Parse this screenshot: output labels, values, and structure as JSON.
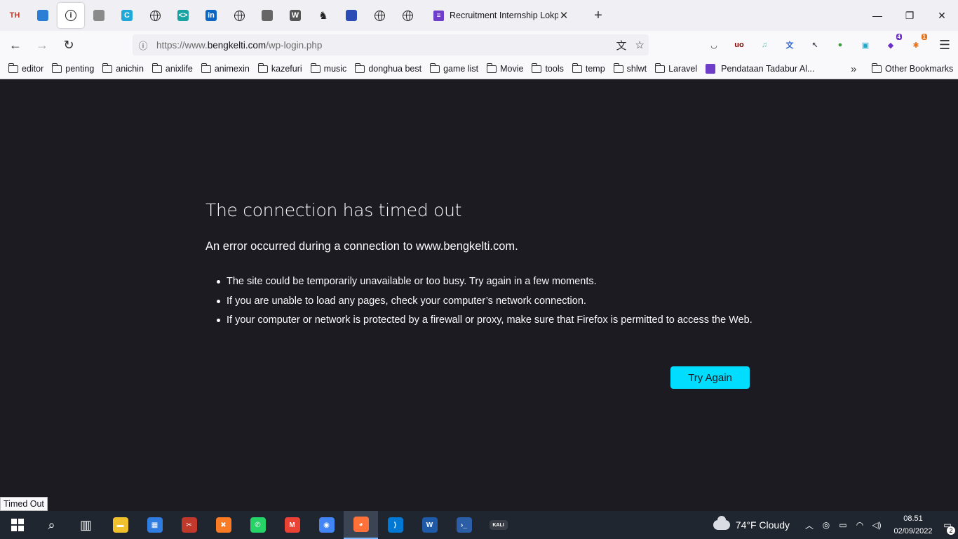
{
  "tabs": {
    "pinned": [
      {
        "icon": "th-logo-icon",
        "glyph": "TH"
      },
      {
        "icon": "box-icon",
        "glyph": ""
      },
      {
        "icon": "info-icon",
        "glyph": "i"
      },
      {
        "icon": "store-icon",
        "glyph": ""
      },
      {
        "icon": "c-logo-icon",
        "glyph": "C"
      },
      {
        "icon": "globe-icon",
        "glyph": ""
      },
      {
        "icon": "code-icon",
        "glyph": "<>"
      },
      {
        "icon": "linkedin-icon",
        "glyph": "in"
      },
      {
        "icon": "globe-icon",
        "glyph": ""
      },
      {
        "icon": "document-icon",
        "glyph": ""
      },
      {
        "icon": "wordpress-icon",
        "glyph": "W"
      },
      {
        "icon": "chess-icon",
        "glyph": "♞"
      },
      {
        "icon": "bank-icon",
        "glyph": ""
      },
      {
        "icon": "globe-icon",
        "glyph": ""
      },
      {
        "icon": "globe-icon",
        "glyph": ""
      }
    ],
    "open_tab_title": "Recruitment Internship Lokpro |",
    "close_glyph": "✕",
    "new_tab_glyph": "+"
  },
  "window_controls": {
    "minimize": "—",
    "restore": "❐",
    "close": "✕"
  },
  "navbar": {
    "back": "←",
    "forward": "→",
    "reload": "↻",
    "url_prefix": "https://www.",
    "url_host": "bengkelti.com",
    "url_path": "/wp-login.php",
    "translate_glyph": "文",
    "star_glyph": "☆",
    "menu_glyph": "☰"
  },
  "extensions": [
    {
      "icon": "pocket-icon",
      "glyph": "◡",
      "color": "#333333",
      "badge": ""
    },
    {
      "icon": "ublock-icon",
      "glyph": "uo",
      "color": "#800000",
      "badge": ""
    },
    {
      "icon": "music-extension-icon",
      "glyph": "♫",
      "color": "#5fbfa8",
      "badge": ""
    },
    {
      "icon": "translate-extension-icon",
      "glyph": "文",
      "color": "#2e64c8",
      "badge": ""
    },
    {
      "icon": "cursor-extension-icon",
      "glyph": "↖",
      "color": "#444a5a",
      "badge": ""
    },
    {
      "icon": "download-extension-icon",
      "glyph": "●",
      "color": "#3c9a3c",
      "badge": ""
    },
    {
      "icon": "save-extension-icon",
      "glyph": "▣",
      "color": "#1ca9c9",
      "badge": ""
    },
    {
      "icon": "purple-extension-icon",
      "glyph": "◆",
      "color": "#6b2fc6",
      "badge": "4"
    },
    {
      "icon": "orange-extension-icon",
      "glyph": "✱",
      "color": "#e8731a",
      "badge": "1"
    }
  ],
  "bookmarks": {
    "items": [
      "editor",
      "penting",
      "anichin",
      "anixlife",
      "animexin",
      "kazefuri",
      "music",
      "donghua best",
      "game list",
      "Movie",
      "tools",
      "temp",
      "shlwt",
      "Laravel"
    ],
    "form_item": "Pendataan Tadabur Al...",
    "more_glyph": "»",
    "other": "Other Bookmarks"
  },
  "error_page": {
    "title": "The connection has timed out",
    "short_desc": "An error occurred during a connection to www.bengkelti.com.",
    "suggestions": [
      "The site could be temporarily unavailable or too busy. Try again in a few moments.",
      "If you are unable to load any pages, check your computer’s network connection.",
      "If your computer or network is protected by a firewall or proxy, make sure that Firefox is permitted to access the Web."
    ],
    "try_again_label": "Try Again"
  },
  "status_tooltip": "Timed Out",
  "taskbar": {
    "apps": [
      {
        "icon": "search-icon",
        "glyph": "⌕",
        "color": ""
      },
      {
        "icon": "task-view-icon",
        "glyph": "▥",
        "color": ""
      },
      {
        "icon": "file-explorer-icon",
        "glyph": "▬",
        "color": "#f2c12e"
      },
      {
        "icon": "store-icon",
        "glyph": "▦",
        "color": "#2f7de1"
      },
      {
        "icon": "snipping-tool-icon",
        "glyph": "✂",
        "color": "#c0392b"
      },
      {
        "icon": "xampp-icon",
        "glyph": "✖",
        "color": "#fb7a24"
      },
      {
        "icon": "whatsapp-icon",
        "glyph": "✆",
        "color": "#25d366"
      },
      {
        "icon": "gmail-icon",
        "glyph": "M",
        "color": "#ea4335"
      },
      {
        "icon": "chrome-icon",
        "glyph": "◉",
        "color": "#4285f4"
      },
      {
        "icon": "firefox-icon",
        "glyph": "◕",
        "color": "#ff7139"
      },
      {
        "icon": "vscode-icon",
        "glyph": "⟩",
        "color": "#0078d4"
      },
      {
        "icon": "writer-icon",
        "glyph": "W",
        "color": "#1e5aa8"
      },
      {
        "icon": "powershell-icon",
        "glyph": "›_",
        "color": "#2c5ea8"
      },
      {
        "icon": "kali-icon",
        "glyph": "KALI",
        "color": "#3a3f47"
      }
    ],
    "active_app": "firefox-icon",
    "weather": "74°F  Cloudy",
    "tray_chevron": "︿",
    "tray_icons": [
      {
        "icon": "meet-now-icon",
        "glyph": "◎"
      },
      {
        "icon": "battery-icon",
        "glyph": "▭"
      },
      {
        "icon": "wifi-icon",
        "glyph": "◠"
      },
      {
        "icon": "volume-icon",
        "glyph": "◁)"
      }
    ],
    "time": "08.51",
    "date": "02/09/2022",
    "notification_count": "2"
  }
}
